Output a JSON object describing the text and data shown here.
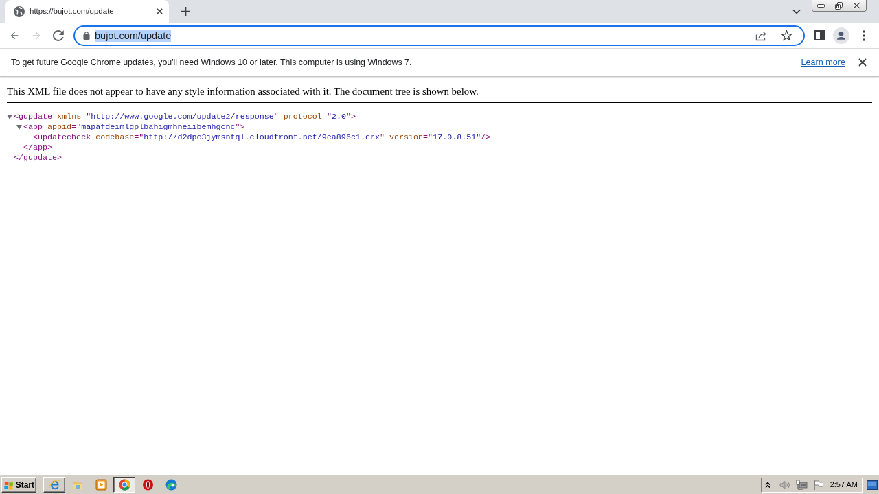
{
  "tabs": [
    {
      "title": "https://bujot.com/update",
      "selected": true
    }
  ],
  "toolbar": {
    "back": {
      "disabled": false
    },
    "forward": {
      "disabled": true
    },
    "address": {
      "value": "bujot.com/update",
      "selected": true
    }
  },
  "infobar": {
    "message": "To get future Google Chrome updates, you'll need Windows 10 or later. This computer is using Windows 7.",
    "link": "Learn more"
  },
  "xml_viewer": {
    "notice": "This XML file does not appear to have any style information associated with it. The document tree is shown below.",
    "tree": [
      {
        "expanded": true,
        "open_tag": [
          {
            "kind": "tag",
            "text": "<gupdate"
          },
          {
            "kind": "name",
            "text": "xmlns"
          },
          {
            "kind": "tag",
            "text": "=\""
          },
          {
            "kind": "value",
            "text": "http://www.google.com/update2/response"
          },
          {
            "kind": "tag",
            "text": "\""
          },
          {
            "kind": "name",
            "text": "protocol"
          },
          {
            "kind": "tag",
            "text": "=\""
          },
          {
            "kind": "value",
            "text": "2.0"
          },
          {
            "kind": "tag",
            "text": "\">"
          }
        ],
        "children": [
          {
            "expanded": true,
            "open_tag": [
              {
                "kind": "tag",
                "text": "<app"
              },
              {
                "kind": "name",
                "text": "appid"
              },
              {
                "kind": "tag",
                "text": "=\""
              },
              {
                "kind": "value",
                "text": "mapafdeimlgplbahigmhneiibemhgcnc"
              },
              {
                "kind": "tag",
                "text": "\">"
              }
            ],
            "children": [
              {
                "open_tag": [
                  {
                    "kind": "tag",
                    "text": "<updatecheck"
                  },
                  {
                    "kind": "name",
                    "text": "codebase"
                  },
                  {
                    "kind": "tag",
                    "text": "=\""
                  },
                  {
                    "kind": "value",
                    "text": "http://d2dpc3jymsntql.cloudfront.net/9ea896c1.crx"
                  },
                  {
                    "kind": "tag",
                    "text": "\""
                  },
                  {
                    "kind": "name",
                    "text": "version"
                  },
                  {
                    "kind": "tag",
                    "text": "=\""
                  },
                  {
                    "kind": "value",
                    "text": "17.0.8.51"
                  },
                  {
                    "kind": "tag",
                    "text": "\"/>"
                  }
                ]
              }
            ],
            "close_tag": [
              {
                "kind": "tag",
                "text": "</app>"
              }
            ]
          }
        ],
        "close_tag": [
          {
            "kind": "tag",
            "text": "</gupdate>"
          }
        ]
      }
    ]
  },
  "taskbar": {
    "start": "Start",
    "apps": [
      {
        "kind": "e-logo",
        "running": true,
        "selected": false
      },
      {
        "kind": "folder",
        "running": false,
        "selected": false
      },
      {
        "kind": "play",
        "running": false,
        "selected": false
      },
      {
        "kind": "circle-logo",
        "running": true,
        "selected": true
      },
      {
        "kind": "o-ring",
        "running": false,
        "selected": false
      },
      {
        "kind": "wave",
        "running": false,
        "selected": false
      }
    ],
    "clock": "2:57 AM"
  }
}
